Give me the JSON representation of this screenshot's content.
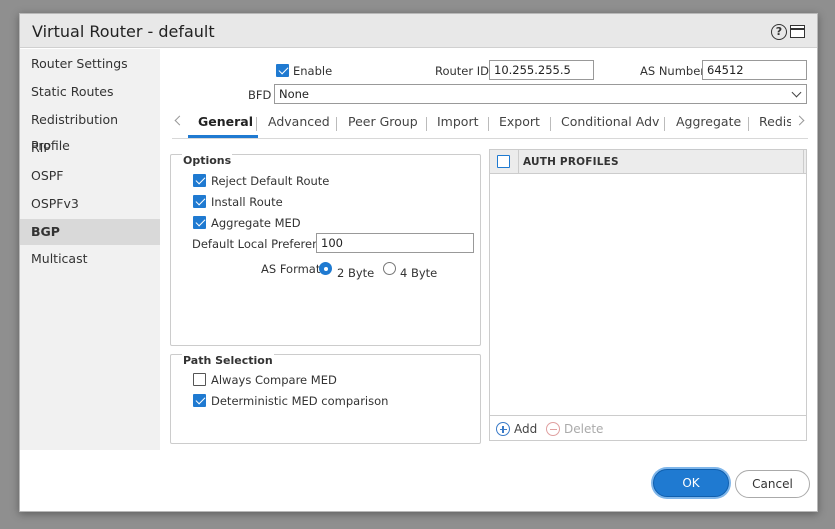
{
  "window": {
    "title": "Virtual Router - default"
  },
  "icons": {
    "help": "help-icon",
    "maximize": "maximize-icon"
  },
  "help_glyph": "?",
  "sidebar": {
    "items": [
      {
        "label": "Router Settings"
      },
      {
        "label": "Static Routes"
      },
      {
        "label": "Redistribution Profile"
      },
      {
        "label": "RIP"
      },
      {
        "label": "OSPF"
      },
      {
        "label": "OSPFv3"
      },
      {
        "label": "BGP",
        "active": true
      },
      {
        "label": "Multicast"
      }
    ]
  },
  "bgp": {
    "enable_label": "Enable",
    "enable_checked": true,
    "router_id_label": "Router ID",
    "router_id_value": "10.255.255.5",
    "as_number_label": "AS Number",
    "as_number_value": "64512",
    "bfd_label": "BFD",
    "bfd_value": "None"
  },
  "tabs": [
    {
      "label": "General",
      "active": true
    },
    {
      "label": "Advanced"
    },
    {
      "label": "Peer Group"
    },
    {
      "label": "Import"
    },
    {
      "label": "Export"
    },
    {
      "label": "Conditional Adv"
    },
    {
      "label": "Aggregate"
    },
    {
      "label": "Redis"
    }
  ],
  "options": {
    "title": "Options",
    "reject_default_route": {
      "label": "Reject Default Route",
      "checked": true
    },
    "install_route": {
      "label": "Install Route",
      "checked": true
    },
    "aggregate_med": {
      "label": "Aggregate MED",
      "checked": true
    },
    "default_local_pref_label": "Default Local Preference",
    "default_local_pref_value": "100",
    "as_format_label": "AS Format",
    "as_format_options": [
      {
        "label": "2 Byte",
        "selected": true
      },
      {
        "label": "4 Byte",
        "selected": false
      }
    ]
  },
  "path_selection": {
    "title": "Path Selection",
    "always_compare_med": {
      "label": "Always Compare MED",
      "checked": false
    },
    "deterministic_med": {
      "label": "Deterministic MED comparison",
      "checked": true
    }
  },
  "auth_profiles": {
    "column": "AUTH PROFILES",
    "rows": [],
    "add_label": "Add",
    "delete_label": "Delete"
  },
  "footer": {
    "ok_label": "OK",
    "cancel_label": "Cancel"
  },
  "colors": {
    "accent": "#1f7ad1",
    "sidebar_bg": "#f1f1f1",
    "sidebar_active": "#d9d9d9"
  }
}
